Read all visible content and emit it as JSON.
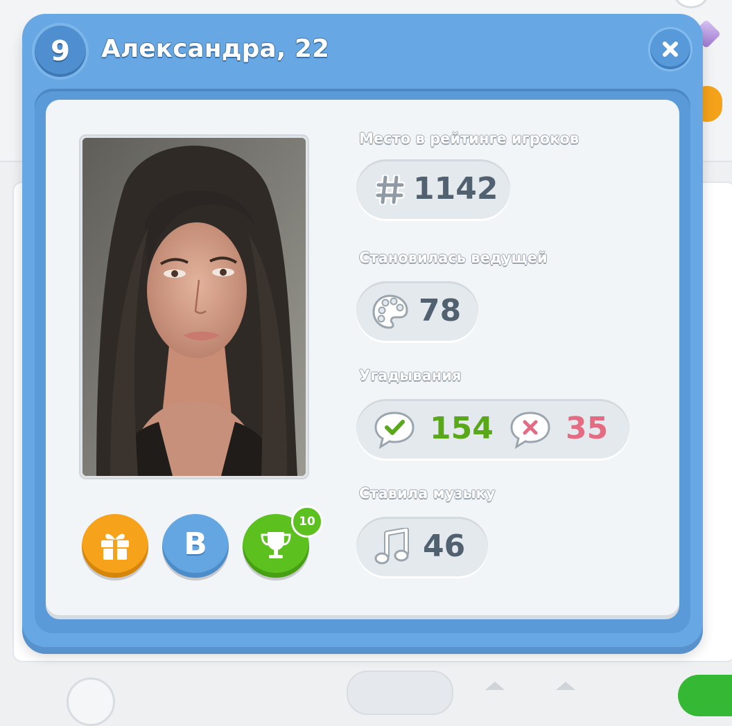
{
  "dialog": {
    "level": "9",
    "title": "Александра, 22"
  },
  "profile": {
    "photo_alt": "profile-photo"
  },
  "actions": {
    "vk_label": "B",
    "trophy_count": "10"
  },
  "stats": {
    "rating": {
      "label": "Место в рейтинге игроков",
      "value": "1142"
    },
    "host": {
      "label": "Становилась ведущей",
      "value": "78"
    },
    "guesses": {
      "label": "Угадывания",
      "correct": "154",
      "wrong": "35"
    },
    "music": {
      "label": "Ставила музыку",
      "value": "46"
    }
  },
  "colors": {
    "dialog": "#67a7e3",
    "card": "#f2f5f7",
    "text": "#516170",
    "correct": "#58a81a",
    "wrong": "#e36c83",
    "gift": "#f7a21b",
    "vk": "#64a6e2",
    "trophy": "#5cc01f"
  },
  "icons": [
    "close-icon",
    "hash-icon",
    "palette-icon",
    "check-bubble-icon",
    "cross-bubble-icon",
    "music-note-icon",
    "gift-icon",
    "trophy-icon"
  ]
}
